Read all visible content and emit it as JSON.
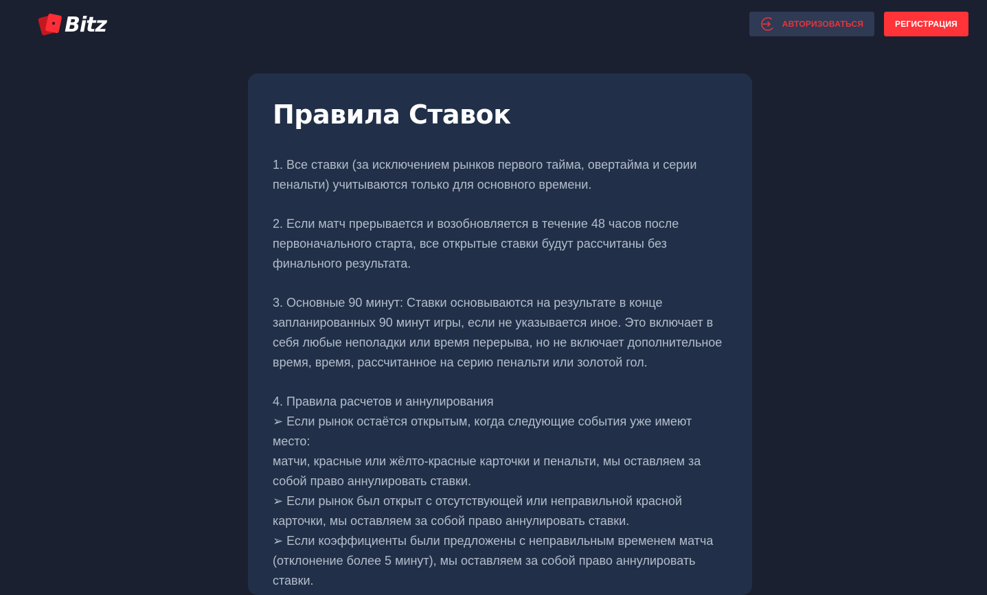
{
  "header": {
    "logo_text": "Bitz",
    "login_label": "АВТОРИЗОВАТЬСЯ",
    "register_label": "РЕГИСТРАЦИЯ"
  },
  "colors": {
    "background": "#1a2030",
    "panel": "#213048",
    "accent": "#ff3338",
    "login_bg": "#2f3a55",
    "text_muted": "#b4bccb"
  },
  "icons": {
    "login": "sign-in-icon",
    "logo": "playing-cards-icon"
  },
  "content": {
    "title": "Правила Ставок",
    "rules": [
      {
        "lines": [
          "1. Все ставки (за исключением рынков первого тайма, овертайма и серии",
          "пенальти) учитываются только для основного времени."
        ]
      },
      {
        "lines": [
          "2. Если матч прерывается и возобновляется в течение 48 часов после",
          "первоначального старта, все открытые ставки будут рассчитаны без",
          "финального результата."
        ]
      },
      {
        "lines": [
          "3. Основные 90 минут: Ставки основываются на результате в конце",
          "запланированных 90 минут игры, если не указывается иное. Это включает в",
          "себя любые неполадки или время перерыва, но не включает дополнительное",
          "время, время, рассчитанное на серию пенальти или золотой гол."
        ]
      },
      {
        "lines": [
          "4. Правила расчетов и аннулирования",
          "➢ Если рынок остаётся открытым, когда следующие события уже имеют место:",
          "матчи, красные или жёлто-красные карточки и пенальти, мы оставляем за",
          "собой право аннулировать ставки.",
          "➢ Если рынок был открыт с отсутствующей или неправильной красной",
          "карточки, мы оставляем за собой право аннулировать ставки.",
          "➢ Если коэффициенты были предложены с неправильным временем матча",
          "(отклонение более 5 минут), мы оставляем за собой право аннулировать",
          "ставки."
        ]
      }
    ]
  }
}
